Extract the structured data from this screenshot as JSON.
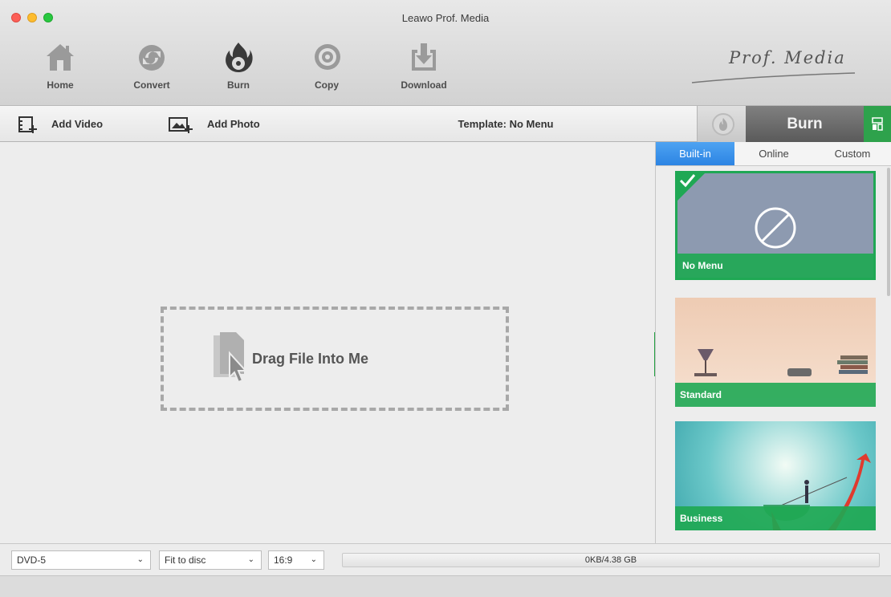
{
  "window": {
    "title": "Leawo Prof. Media"
  },
  "toolbar": {
    "items": [
      {
        "label": "Home",
        "icon": "home-icon"
      },
      {
        "label": "Convert",
        "icon": "convert-icon"
      },
      {
        "label": "Burn",
        "icon": "burn-icon"
      },
      {
        "label": "Copy",
        "icon": "copy-icon"
      },
      {
        "label": "Download",
        "icon": "download-icon"
      }
    ],
    "brand": "Prof. Media"
  },
  "subbar": {
    "add_video": "Add Video",
    "add_photo": "Add Photo",
    "template": "Template: No Menu",
    "burn_button": "Burn"
  },
  "main": {
    "drop_label": "Drag File Into Me"
  },
  "panel": {
    "tabs": [
      "Built-in",
      "Online",
      "Custom"
    ],
    "active_tab": "Built-in",
    "templates": [
      {
        "name": "No Menu",
        "selected": true
      },
      {
        "name": "Standard",
        "selected": false
      },
      {
        "name": "Business",
        "selected": false
      }
    ]
  },
  "bottom": {
    "disc_type": "DVD-5",
    "fit_mode": "Fit to disc",
    "aspect": "16:9",
    "capacity": "0KB/4.38 GB"
  },
  "colors": {
    "accent_green": "#1fa854",
    "tab_blue": "#2c84e3"
  }
}
